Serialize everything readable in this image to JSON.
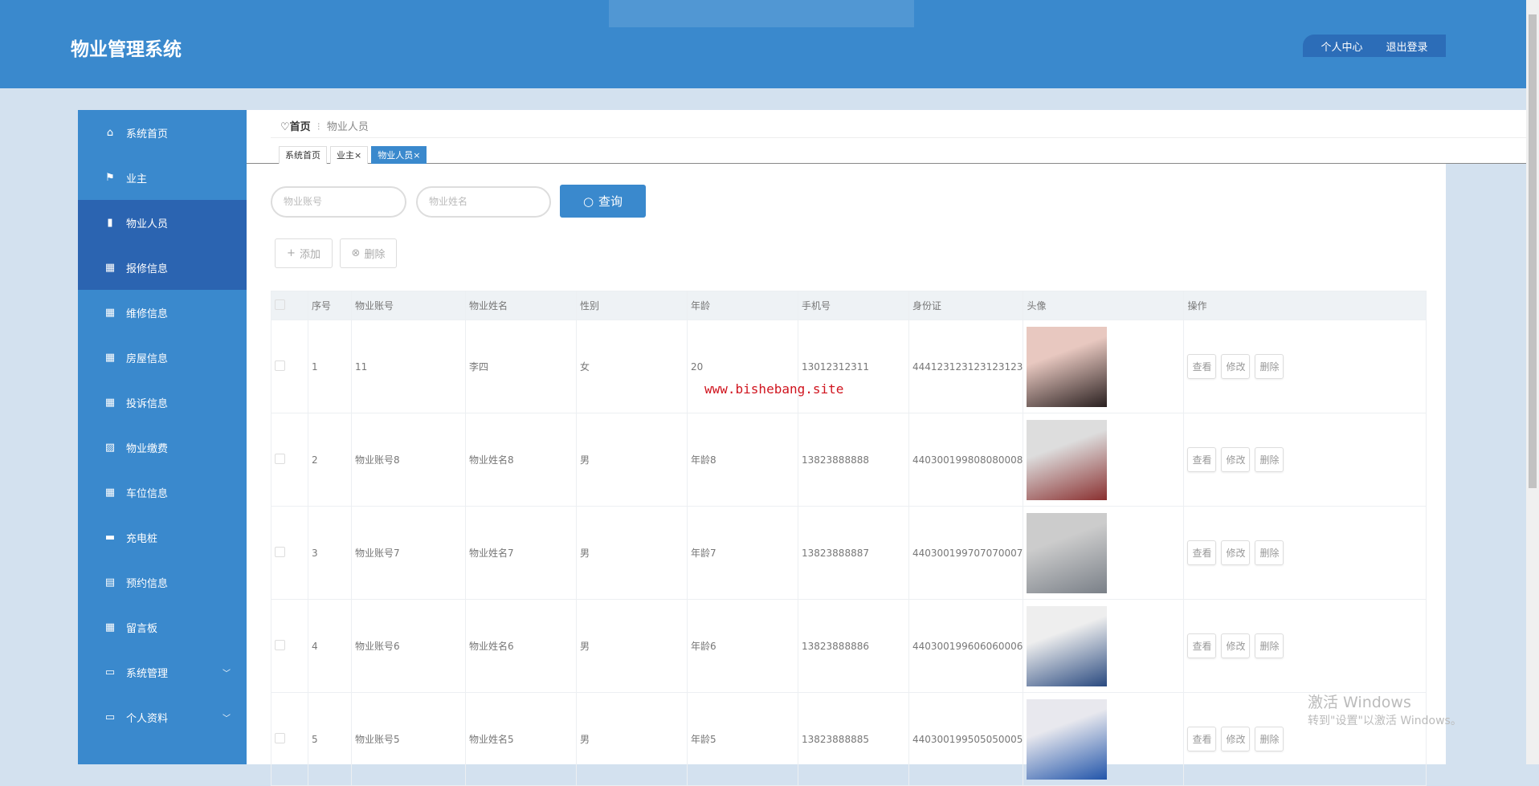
{
  "header": {
    "title": "物业管理系统",
    "personal_center": "个人中心",
    "logout": "退出登录"
  },
  "sidebar": {
    "items": [
      {
        "label": "系统首页",
        "icon": "home-icon",
        "glyph": "⌂"
      },
      {
        "label": "业主",
        "icon": "flag-icon",
        "glyph": "⚑"
      },
      {
        "label": "物业人员",
        "icon": "bar-chart-icon",
        "glyph": "▮"
      },
      {
        "label": "报修信息",
        "icon": "grid-icon",
        "glyph": "▦"
      },
      {
        "label": "维修信息",
        "icon": "grid-icon",
        "glyph": "▦"
      },
      {
        "label": "房屋信息",
        "icon": "grid-icon",
        "glyph": "▦"
      },
      {
        "label": "投诉信息",
        "icon": "grid-icon",
        "glyph": "▦"
      },
      {
        "label": "物业缴费",
        "icon": "chart-icon",
        "glyph": "▨"
      },
      {
        "label": "车位信息",
        "icon": "grid-icon",
        "glyph": "▦"
      },
      {
        "label": "充电桩",
        "icon": "briefcase-icon",
        "glyph": "▬"
      },
      {
        "label": "预约信息",
        "icon": "clipboard-icon",
        "glyph": "▤"
      },
      {
        "label": "留言板",
        "icon": "grid-icon",
        "glyph": "▦"
      },
      {
        "label": "系统管理",
        "icon": "monitor-icon",
        "glyph": "▭"
      },
      {
        "label": "个人资料",
        "icon": "card-icon",
        "glyph": "▭"
      }
    ]
  },
  "breadcrumb": {
    "home": "首页",
    "separator": "⁝",
    "current": "物业人员"
  },
  "tabs": [
    {
      "label": "系统首页"
    },
    {
      "label": "业主×"
    },
    {
      "label": "物业人员×"
    }
  ],
  "search": {
    "account_placeholder": "物业账号",
    "name_placeholder": "物业姓名",
    "query": "查询"
  },
  "actions": {
    "add": "添加",
    "delete": "删除"
  },
  "table": {
    "headers": [
      "序号",
      "物业账号",
      "物业姓名",
      "性别",
      "年龄",
      "手机号",
      "身份证",
      "头像",
      "操作"
    ],
    "rows": [
      {
        "no": "1",
        "account": "11",
        "name": "李四",
        "gender": "女",
        "age": "20",
        "phone": "13012312311",
        "id": "444123123123123123"
      },
      {
        "no": "2",
        "account": "物业账号8",
        "name": "物业姓名8",
        "gender": "男",
        "age": "年龄8",
        "phone": "13823888888",
        "id": "440300199808080008"
      },
      {
        "no": "3",
        "account": "物业账号7",
        "name": "物业姓名7",
        "gender": "男",
        "age": "年龄7",
        "phone": "13823888887",
        "id": "440300199707070007"
      },
      {
        "no": "4",
        "account": "物业账号6",
        "name": "物业姓名6",
        "gender": "男",
        "age": "年龄6",
        "phone": "13823888886",
        "id": "440300199606060006"
      },
      {
        "no": "5",
        "account": "物业账号5",
        "name": "物业姓名5",
        "gender": "男",
        "age": "年龄5",
        "phone": "13823888885",
        "id": "440300199505050005"
      }
    ],
    "ops": {
      "view": "查看",
      "edit": "修改",
      "delete": "删除"
    }
  },
  "watermark": "www.bishebang.site",
  "windows": {
    "line1": "激活 Windows",
    "line2": "转到\"设置\"以激活 Windows。"
  },
  "colors": {
    "primary": "#3a89cd",
    "active": "#2b64b1"
  }
}
